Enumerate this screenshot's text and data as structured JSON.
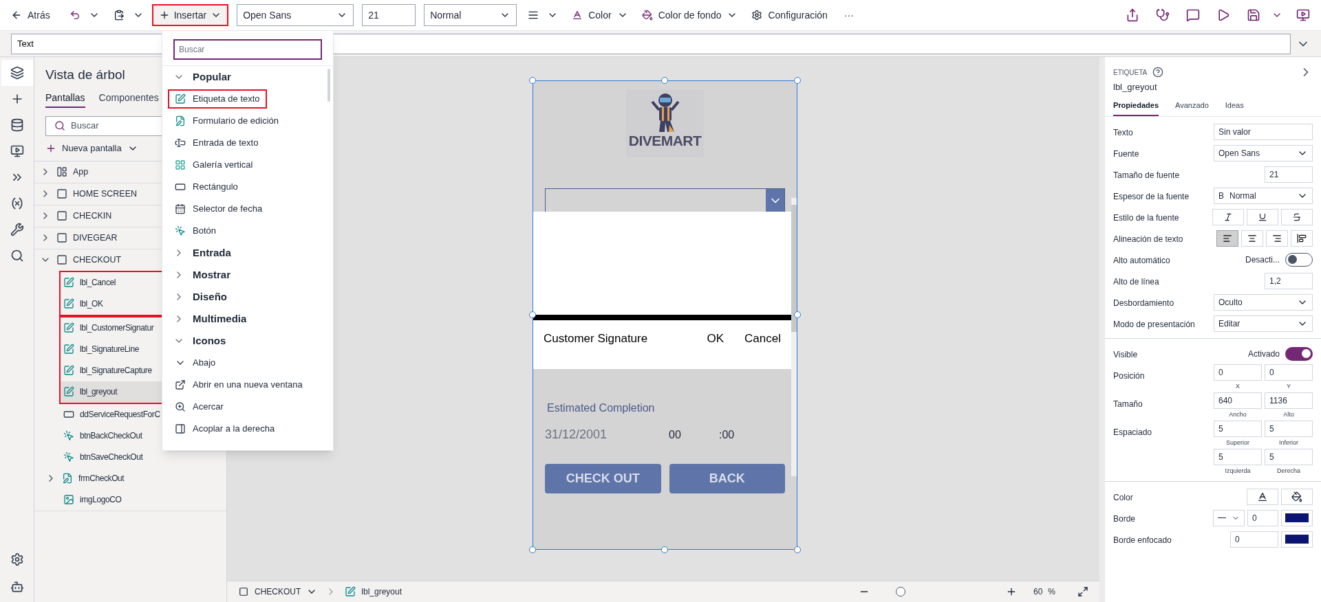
{
  "toolbar": {
    "back": "Atrás",
    "insert": {
      "label": "Insertar",
      "highlighted": true
    },
    "font": "Open Sans",
    "size": "21",
    "weight": "Normal",
    "color_label": "Color",
    "fill_label": "Color de fondo",
    "settings": "Configuración",
    "more": "···"
  },
  "formula_bar": {
    "property": "Text"
  },
  "rail": [
    {
      "kind": "layers",
      "selected": true
    },
    {
      "kind": "plus",
      "selected": false
    },
    {
      "kind": "data",
      "selected": false
    },
    {
      "kind": "media",
      "selected": false
    },
    {
      "kind": "flow",
      "selected": false
    },
    {
      "kind": "variables",
      "selected": false
    },
    {
      "kind": "tools",
      "selected": false
    },
    {
      "kind": "search",
      "selected": false
    }
  ],
  "tree": {
    "title": "Vista de árbol",
    "tabs": [
      {
        "label": "Pantallas",
        "selected": true
      },
      {
        "label": "Componentes",
        "selected": false
      }
    ],
    "search_placeholder": "Buscar",
    "new_screen": "Nueva pantalla",
    "items": [
      {
        "label": "App",
        "kind": "app",
        "expanded": false
      },
      {
        "label": "HOME SCREEN",
        "kind": "screen",
        "expanded": false
      },
      {
        "label": "CHECKIN",
        "kind": "screen",
        "expanded": false
      },
      {
        "label": "DIVEGEAR",
        "kind": "screen",
        "expanded": false
      },
      {
        "label": "CHECKOUT",
        "kind": "screen",
        "expanded": true,
        "groups": [
          {
            "highlighted": true,
            "children": [
              {
                "label": "lbl_Cancel",
                "kind": "label",
                "selected": false
              },
              {
                "label": "lbl_OK",
                "kind": "label",
                "selected": false
              }
            ]
          },
          {
            "highlighted": true,
            "children": [
              {
                "label": "lbl_CustomerSignatur",
                "kind": "label",
                "selected": false
              },
              {
                "label": "lbl_SignatureLine",
                "kind": "label",
                "selected": false
              },
              {
                "label": "lbl_SignatureCapture",
                "kind": "label",
                "selected": false
              },
              {
                "label": "lbl_greyout",
                "kind": "label",
                "selected": true
              }
            ]
          },
          {
            "highlighted": false,
            "children": [
              {
                "label": "ddServiceRequestForC",
                "kind": "dropdown",
                "selected": false
              },
              {
                "label": "btnBackCheckOut",
                "kind": "button",
                "selected": false
              },
              {
                "label": "btnSaveCheckOut",
                "kind": "button",
                "selected": false
              },
              {
                "label": "frmCheckOut",
                "kind": "form",
                "selected": false,
                "expanded": false
              },
              {
                "label": "imgLogoCO",
                "kind": "image",
                "selected": false
              }
            ]
          }
        ]
      }
    ]
  },
  "insert_menu": {
    "search_placeholder": "Buscar",
    "items": [
      {
        "kind": "category",
        "label": "Popular",
        "expanded": true
      },
      {
        "kind": "label",
        "label": "Etiqueta de texto",
        "highlighted": true
      },
      {
        "kind": "form",
        "label": "Formulario de edición",
        "highlighted": false
      },
      {
        "kind": "input",
        "label": "Entrada de texto",
        "highlighted": false
      },
      {
        "kind": "gallery",
        "label": "Galería vertical",
        "highlighted": false
      },
      {
        "kind": "rect",
        "label": "Rectángulo",
        "highlighted": false
      },
      {
        "kind": "calendar",
        "label": "Selector de fecha",
        "highlighted": false
      },
      {
        "kind": "button",
        "label": "Botón",
        "highlighted": false
      },
      {
        "kind": "category",
        "label": "Entrada",
        "expanded": false
      },
      {
        "kind": "category",
        "label": "Mostrar",
        "expanded": false
      },
      {
        "kind": "category",
        "label": "Diseño",
        "expanded": false
      },
      {
        "kind": "category",
        "label": "Multimedia",
        "expanded": false
      },
      {
        "kind": "category",
        "label": "Iconos",
        "expanded": true
      },
      {
        "kind": "down",
        "label": "Abajo",
        "highlighted": false
      },
      {
        "kind": "newwindow",
        "label": "Abrir en una nueva ventana",
        "highlighted": false
      },
      {
        "kind": "zoomin",
        "label": "Acercar",
        "highlighted": false
      },
      {
        "kind": "dock",
        "label": "Acoplar a la derecha",
        "highlighted": false
      }
    ]
  },
  "phone": {
    "logo_text": "DIVEMART",
    "signature": {
      "caption": "Customer Signature",
      "ok": "OK",
      "cancel": "Cancel"
    },
    "estimated_label": "Estimated Completion",
    "date": "31/12/2001",
    "hour": "00",
    "minute": ":00",
    "buttons": [
      "CHECK OUT",
      "BACK"
    ]
  },
  "properties": {
    "type": "ETIQUETA",
    "name": "lbl_greyout",
    "tabs": [
      {
        "label": "Propiedades",
        "selected": true
      },
      {
        "label": "Avanzado",
        "selected": false
      },
      {
        "label": "Ideas",
        "selected": false
      }
    ],
    "sections": [
      [
        {
          "kind": "input",
          "label": "Texto",
          "placeholder": "Sin valor"
        },
        {
          "kind": "select",
          "label": "Fuente",
          "value": "Open Sans"
        },
        {
          "kind": "number",
          "label": "Tamaño de fuente",
          "value": "21"
        },
        {
          "kind": "select",
          "label": "Espesor de la fuente",
          "prefix": "B",
          "value": "Normal"
        },
        {
          "kind": "styles",
          "label": "Estilo de la fuente"
        },
        {
          "kind": "align",
          "label": "Alineación de texto",
          "options": [
            {
              "kind": "left",
              "selected": true
            },
            {
              "kind": "center",
              "selected": false
            },
            {
              "kind": "right",
              "selected": false
            },
            {
              "kind": "justify",
              "selected": false
            }
          ]
        },
        {
          "kind": "toggle",
          "label": "Alto automático",
          "state_text": "Desacti...",
          "on": false
        },
        {
          "kind": "number",
          "label": "Alto de línea",
          "value": "1,2"
        },
        {
          "kind": "select",
          "label": "Desbordamiento",
          "value": "Oculto"
        },
        {
          "kind": "select",
          "label": "Modo de presentación",
          "value": "Editar"
        }
      ],
      [
        {
          "kind": "toggle",
          "label": "Visible",
          "state_text": "Activado",
          "on": true
        },
        {
          "kind": "pair",
          "label": "Posición",
          "fields": [
            {
              "value": "0",
              "caption": "X"
            },
            {
              "value": "0",
              "caption": "Y"
            }
          ]
        },
        {
          "kind": "pair",
          "label": "Tamaño",
          "fields": [
            {
              "value": "640",
              "caption": "Ancho"
            },
            {
              "value": "1136",
              "caption": "Alto"
            }
          ]
        },
        {
          "kind": "pair",
          "label": "Espaciado",
          "fields": [
            {
              "value": "5",
              "caption": "Superior"
            },
            {
              "value": "5",
              "caption": "Inferior"
            }
          ]
        },
        {
          "kind": "pair",
          "fields": [
            {
              "value": "5",
              "caption": "Izquierda"
            },
            {
              "value": "5",
              "caption": "Derecha"
            }
          ]
        }
      ],
      [
        {
          "kind": "colors",
          "label": "Color"
        },
        {
          "kind": "border",
          "label": "Borde",
          "value": "0",
          "color": "#0b1470"
        },
        {
          "kind": "focus_border",
          "label": "Borde enfocado",
          "value": "0",
          "color": "#0b1470"
        }
      ]
    ]
  },
  "bottom_bar": {
    "screen": "CHECKOUT",
    "control": "lbl_greyout",
    "zoom": {
      "level": 0.1,
      "value": "60",
      "unit": "%"
    }
  }
}
